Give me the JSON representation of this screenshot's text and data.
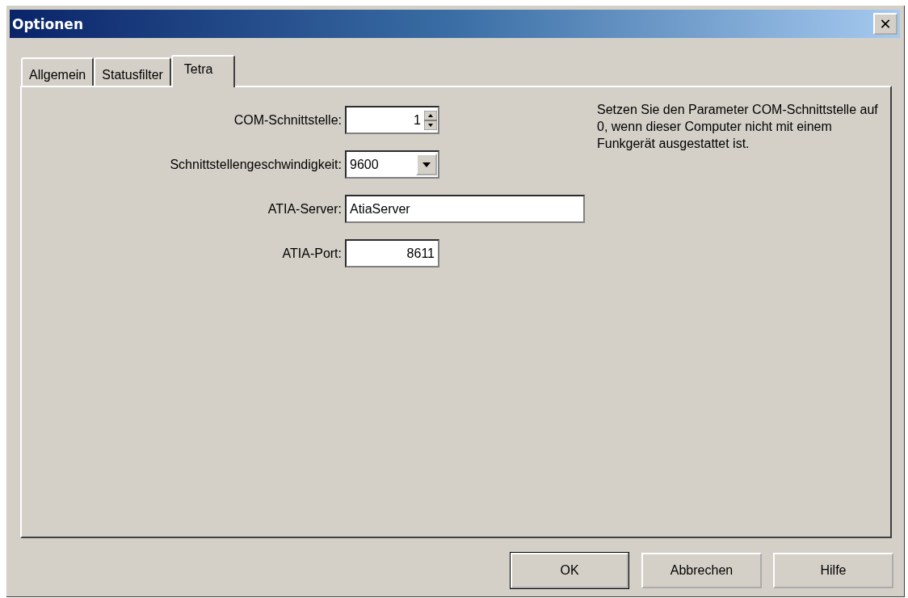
{
  "window": {
    "title": "Optionen",
    "close": "✕"
  },
  "tabs": [
    {
      "label": "Allgemein",
      "selected": false
    },
    {
      "label": "Statusfilter",
      "selected": false
    },
    {
      "label": "Tetra",
      "selected": true
    }
  ],
  "fields": [
    {
      "kind": "spinner",
      "label": "COM-Schnittstelle:",
      "value": "1"
    },
    {
      "kind": "dropdown",
      "label": "Schnittstellengeschwindigkeit:",
      "value": "9600"
    },
    {
      "kind": "text",
      "label": "ATIA-Server:",
      "value": "AtiaServer"
    },
    {
      "kind": "number",
      "label": "ATIA-Port:",
      "value": "8611"
    }
  ],
  "hint": "Setzen Sie den Parameter COM-Schnittstelle auf 0, wenn dieser Computer nicht mit einem Funkgerät ausgestattet ist.",
  "buttons": [
    {
      "label": "OK",
      "default": true
    },
    {
      "label": "Abbrechen",
      "default": false
    },
    {
      "label": "Hilfe",
      "default": false
    }
  ]
}
